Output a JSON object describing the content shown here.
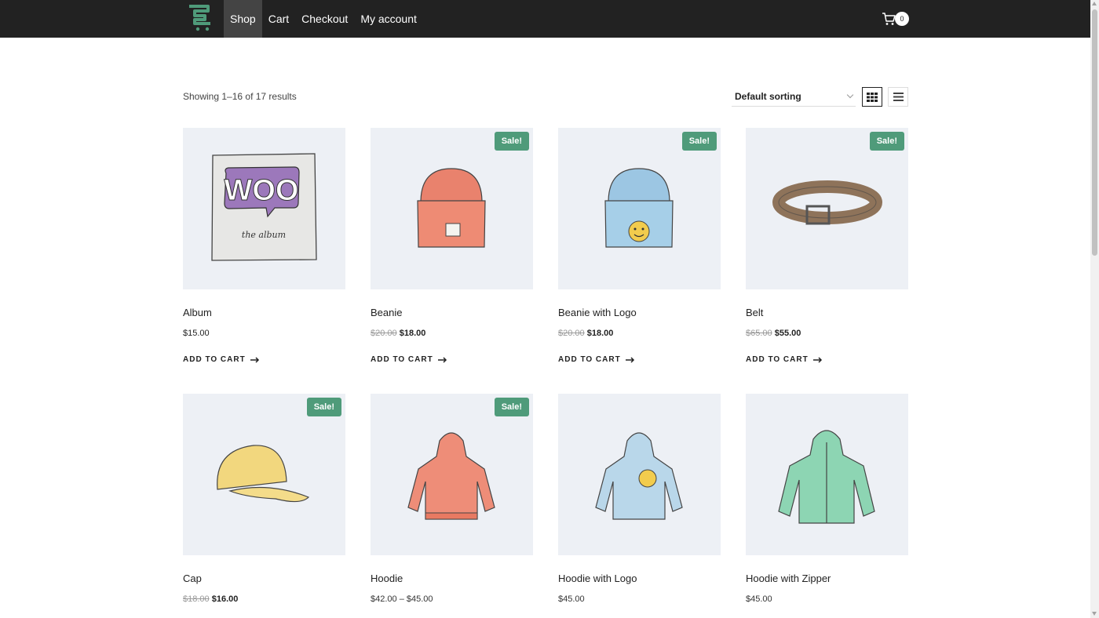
{
  "nav": {
    "items": [
      "Shop",
      "Cart",
      "Checkout",
      "My account"
    ],
    "active": "Shop"
  },
  "cart": {
    "count": "0"
  },
  "toolbar": {
    "result_count": "Showing 1–16 of 17 results",
    "sorting": "Default sorting"
  },
  "products": [
    {
      "name": "Album",
      "price": "$15.00",
      "add_to_cart": "ADD TO CART"
    },
    {
      "name": "Beanie",
      "old_price": "$20.00",
      "price": "$18.00",
      "sale": "Sale!",
      "add_to_cart": "ADD TO CART"
    },
    {
      "name": "Beanie with Logo",
      "old_price": "$20.00",
      "price": "$18.00",
      "sale": "Sale!",
      "add_to_cart": "ADD TO CART"
    },
    {
      "name": "Belt",
      "old_price": "$65.00",
      "price": "$55.00",
      "sale": "Sale!",
      "add_to_cart": "ADD TO CART"
    },
    {
      "name": "Cap",
      "old_price": "$18.00",
      "price": "$16.00",
      "sale": "Sale!"
    },
    {
      "name": "Hoodie",
      "price": "$42.00 – $45.00",
      "sale": "Sale!"
    },
    {
      "name": "Hoodie with Logo",
      "price": "$45.00"
    },
    {
      "name": "Hoodie with Zipper",
      "price": "$45.00"
    }
  ],
  "album_art": {
    "logo": "WOO",
    "caption": "the album"
  },
  "colors": {
    "header_bg": "#222222",
    "active_nav_bg": "#444444",
    "sale_badge": "#4f9b7a",
    "thumb_bg": "#edf0f5",
    "brand_green": "#4f9b7a"
  },
  "icons": [
    "store-logo-icon",
    "cart-icon",
    "grid-view-icon",
    "list-view-icon",
    "arrow-right-icon"
  ]
}
